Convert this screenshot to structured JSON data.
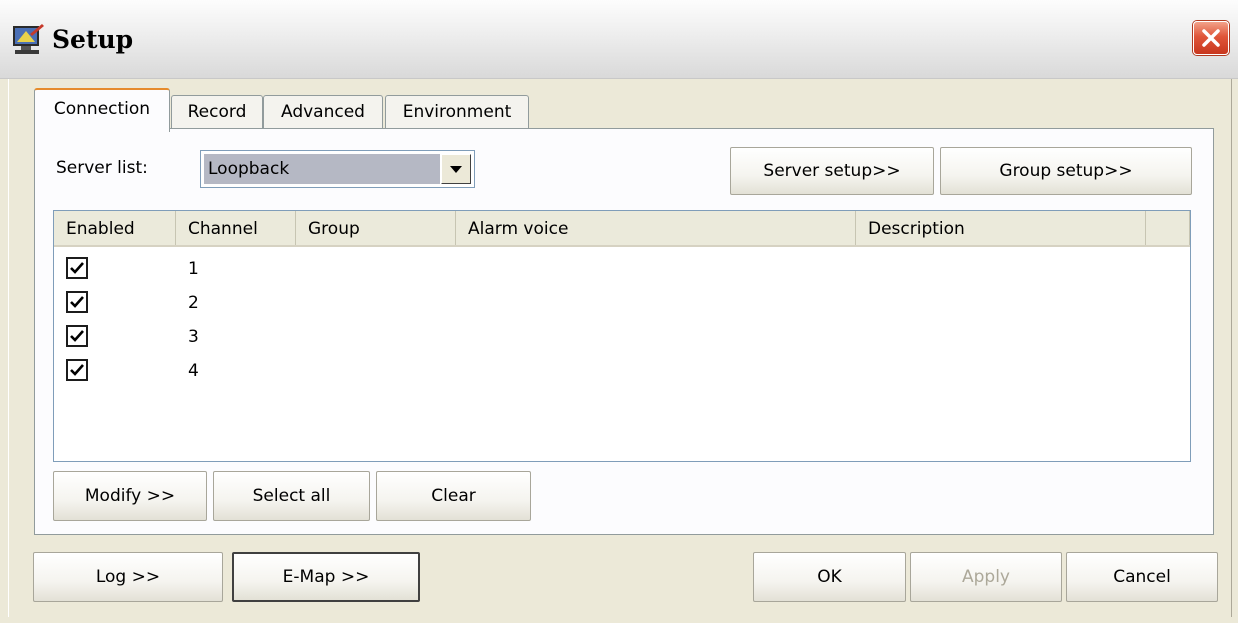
{
  "window": {
    "title": "Setup",
    "app_icon": "computer-icon",
    "close_icon": "close-icon"
  },
  "tabs": [
    {
      "label": "Connection",
      "active": true
    },
    {
      "label": "Record"
    },
    {
      "label": "Advanced"
    },
    {
      "label": "Environment"
    }
  ],
  "server_list": {
    "label": "Server list:",
    "selected": "Loopback"
  },
  "server_setup_label": "Server setup>>",
  "group_setup_label": "Group setup>>",
  "table": {
    "columns": [
      "Enabled",
      "Channel",
      "Group",
      "Alarm voice",
      "Description"
    ],
    "rows": [
      {
        "enabled": true,
        "channel": "1"
      },
      {
        "enabled": true,
        "channel": "2"
      },
      {
        "enabled": true,
        "channel": "3"
      },
      {
        "enabled": true,
        "channel": "4"
      }
    ]
  },
  "list_buttons": {
    "modify": "Modify >>",
    "select_all": "Select all",
    "clear": "Clear"
  },
  "footer": {
    "log": "Log >>",
    "emap": "E-Map >>",
    "ok": "OK",
    "apply": "Apply",
    "cancel": "Cancel"
  }
}
